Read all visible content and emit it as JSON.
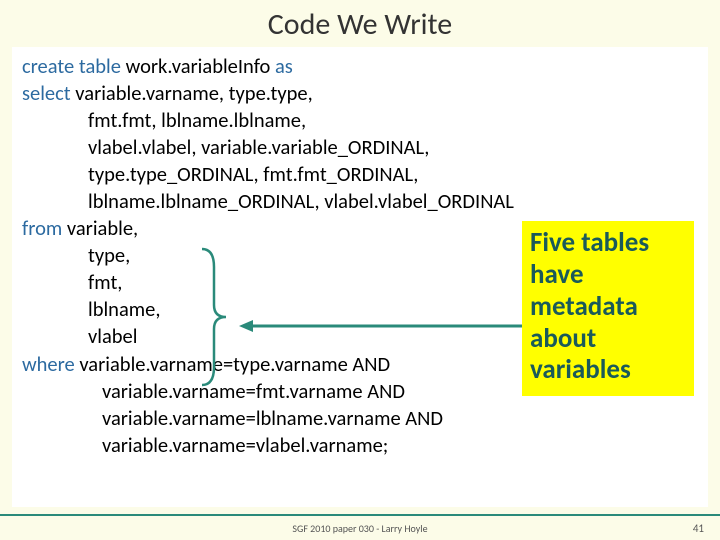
{
  "title": "Code We Write",
  "code": {
    "l1a": "create table ",
    "l1b": "work.variableInfo ",
    "l1c": "as",
    "l2a": "select ",
    "l2b": "variable.varname,   type.type,",
    "l3": "fmt.fmt,    lblname.lblname,",
    "l4": "vlabel.vlabel,  variable.variable_ORDINAL,",
    "l5": "type.type_ORDINAL,          fmt.fmt_ORDINAL,",
    "l6": "lblname.lblname_ORDINAL, vlabel.vlabel_ORDINAL",
    "l7a": "from  ",
    "l7b": "variable,",
    "l8": "type,",
    "l9": "fmt,",
    "l10": "lblname,",
    "l11": "vlabel",
    "l12a": "where ",
    "l12b": "variable.varname=type.varname      AND",
    "l13": "variable.varname=fmt.varname        AND",
    "l14": "variable.varname=lblname.varname AND",
    "l15": "variable.varname=vlabel.varname;"
  },
  "callout": "Five tables have metadata about variables",
  "footer": "SGF 2010 paper 030 - Larry Hoyle",
  "page": "41"
}
